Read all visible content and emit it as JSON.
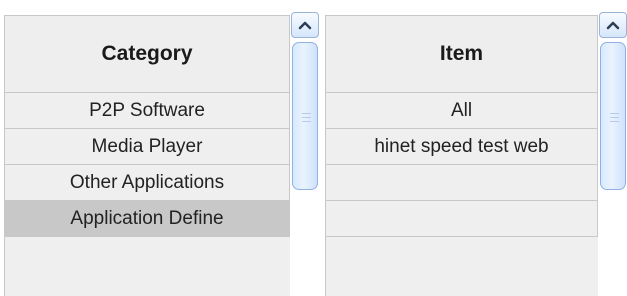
{
  "category_list": {
    "header": "Category",
    "rows": [
      "P2P Software",
      "Media Player",
      "Other Applications",
      "Application Define"
    ],
    "selected_index": 3
  },
  "item_list": {
    "header": "Item",
    "rows": [
      "All",
      "hinet speed test web",
      "",
      ""
    ]
  },
  "icons": {
    "scroll_up": "chevron-up-icon",
    "scroll_grip": "grip-lines-icon"
  },
  "colors": {
    "selected_row": "#c8c8c8",
    "row_bg": "#efefef",
    "scrollbar_accent": "#8fb2e0"
  }
}
